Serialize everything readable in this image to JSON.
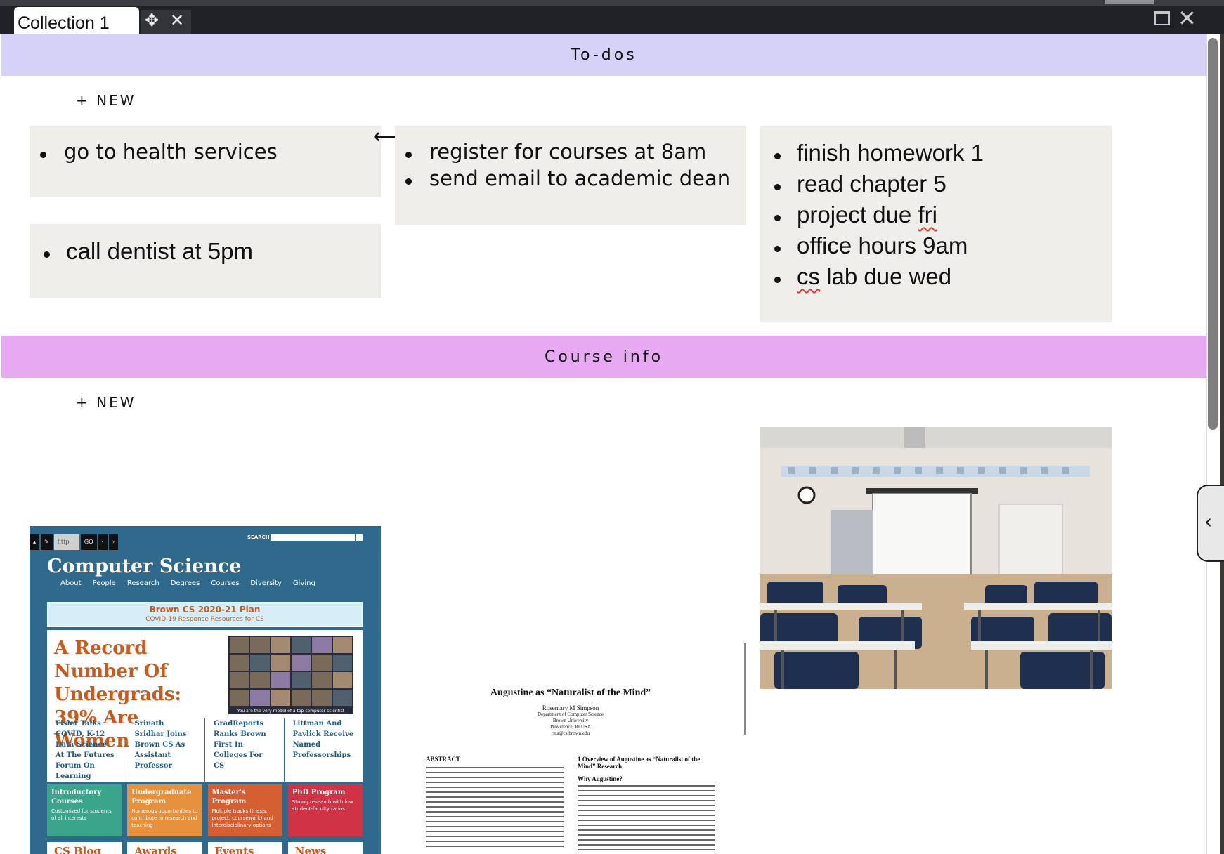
{
  "window": {
    "tab_title": "Collection 1",
    "move_icon": "move-icon",
    "close_tab_icon": "close-icon",
    "maximize_icon": "maximize-icon",
    "close_window_icon": "close-icon"
  },
  "colors": {
    "todos_header": "#d6d2f7",
    "course_header": "#e8a9f3",
    "card_bg": "#efeeea"
  },
  "sections": {
    "todos": {
      "title": "To-dos",
      "new_label": "+ NEW"
    },
    "course_info": {
      "title": "Course info",
      "new_label": "+ NEW"
    }
  },
  "todo_cards": {
    "card1": [
      "go to health services"
    ],
    "card2": [
      "register for courses at 8am",
      "send email to academic dean"
    ],
    "card3": [
      "finish homework 1",
      "read chapter 5",
      "project due fri",
      "office hours 9am",
      "cs lab due wed"
    ],
    "card4": [
      "call dentist at 5pm"
    ]
  },
  "cs_site": {
    "search_label": "SEARCH",
    "url_label": "http",
    "go_label": "GO",
    "title": "Computer Science",
    "nav": [
      "About",
      "People",
      "Research",
      "Degrees",
      "Courses",
      "Diversity",
      "Giving"
    ],
    "plan_title": "Brown CS 2020-21 Plan",
    "plan_sub": "COVID-19 Response Resources for CS",
    "headline": "A Record Number Of Undergrads: 39% Are Women",
    "photo_caption": "You are the very model of a top computer scientist",
    "news": [
      "Fisler Talks COVID, K-12 Data Science At The Futures Forum On Learning",
      "Srinath Sridhar Joins Brown CS As Assistant Professor",
      "GradReports Ranks Brown First In Colleges For CS",
      "Littman And Pavlick Receive Named Professorships"
    ],
    "programs": [
      {
        "title": "Introductory Courses",
        "desc": "Customized for students of all interests",
        "color": "#3aa58a"
      },
      {
        "title": "Undergraduate Program",
        "desc": "Numerous opportunities to contribute to research and teaching",
        "color": "#e8913c"
      },
      {
        "title": "Master's Program",
        "desc": "Multiple tracks (thesis, project, coursework) and interdisciplinary options",
        "color": "#d35f32"
      },
      {
        "title": "PhD Program",
        "desc": "Strong research with low student-faculty ratios",
        "color": "#cf3345"
      }
    ],
    "bottom": [
      "CS Blog",
      "Awards",
      "Events",
      "News"
    ]
  },
  "paper": {
    "title": "Augustine as “Naturalist of the Mind”",
    "author": "Rosemary M Simpson",
    "affiliation": [
      "Department of Computer Science",
      "Brown University",
      "Providence, RI USA",
      "rms@cs.brown.edu"
    ],
    "abstract_heading": "ABSTRACT",
    "section_heading": "1 Overview of Augustine as “Naturalist of the Mind” Research",
    "subheading": "Why Augustine?"
  },
  "side_panel": {
    "toggle_icon": "chevron-left-icon"
  }
}
